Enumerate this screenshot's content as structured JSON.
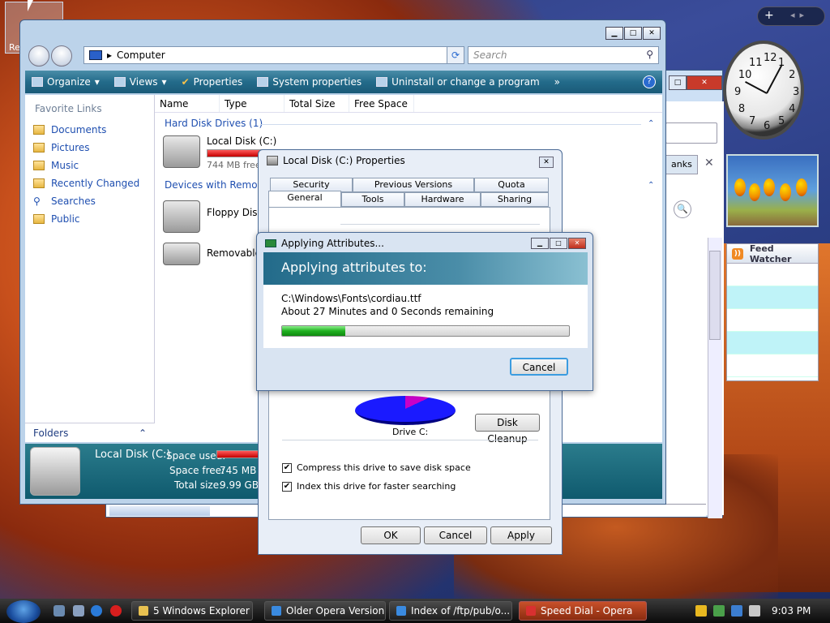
{
  "desktop": {
    "icon_label": "Re"
  },
  "gadgets": {
    "clock_numbers": [
      "12",
      "1",
      "2",
      "3",
      "4",
      "5",
      "6",
      "7",
      "8",
      "9",
      "10",
      "11"
    ],
    "feed_title": "Feed Watcher"
  },
  "opera": {
    "thanks_label": "anks"
  },
  "explorer": {
    "address": "Computer",
    "search_placeholder": "Search",
    "toolbar": {
      "organize": "Organize",
      "views": "Views",
      "properties": "Properties",
      "system_properties": "System properties",
      "uninstall": "Uninstall or change a program",
      "more": "»"
    },
    "nav": {
      "header": "Favorite Links",
      "items": [
        "Documents",
        "Pictures",
        "Music",
        "Recently Changed",
        "Searches",
        "Public"
      ],
      "folders": "Folders"
    },
    "columns": [
      "Name",
      "Type",
      "Total Size",
      "Free Space"
    ],
    "groups": {
      "hard_disks": "Hard Disk Drives (1)",
      "removable": "Devices with Removal"
    },
    "drives": {
      "c_label": "Local Disk (C:)",
      "c_free": "744 MB free",
      "floppy": "Floppy Disk",
      "removable": "Removable"
    },
    "details": {
      "name": "Local Disk (C:)",
      "space_used_label": "Space used:",
      "space_free_label": "Space free:",
      "space_free_value": "745 MB",
      "total_size_label": "Total size:",
      "total_size_value": "9.99 GB"
    }
  },
  "properties": {
    "title": "Local Disk (C:) Properties",
    "tabs_top": [
      "Security",
      "Previous Versions",
      "Quota"
    ],
    "tabs_bottom": [
      "General",
      "Tools",
      "Hardware",
      "Sharing"
    ],
    "drive_label": "Drive C:",
    "disk_cleanup": "Disk Cleanup",
    "compress": "Compress this drive to save disk space",
    "index": "Index this drive for faster searching",
    "ok": "OK",
    "cancel": "Cancel",
    "apply": "Apply"
  },
  "apply_dialog": {
    "title": "Applying Attributes...",
    "banner": "Applying attributes to:",
    "file": "C:\\Windows\\Fonts\\cordiau.ttf",
    "remaining": "About 27 Minutes and 0 Seconds remaining",
    "progress": 0.22,
    "cancel": "Cancel"
  },
  "taskbar": {
    "tasks": [
      {
        "label": "5 Windows Explorer",
        "active": false
      },
      {
        "label": "Older Opera Version...",
        "active": false
      },
      {
        "label": "Index of /ftp/pub/o...",
        "active": false
      },
      {
        "label": "Speed Dial - Opera",
        "active": true
      }
    ],
    "time": "9:03 PM"
  }
}
